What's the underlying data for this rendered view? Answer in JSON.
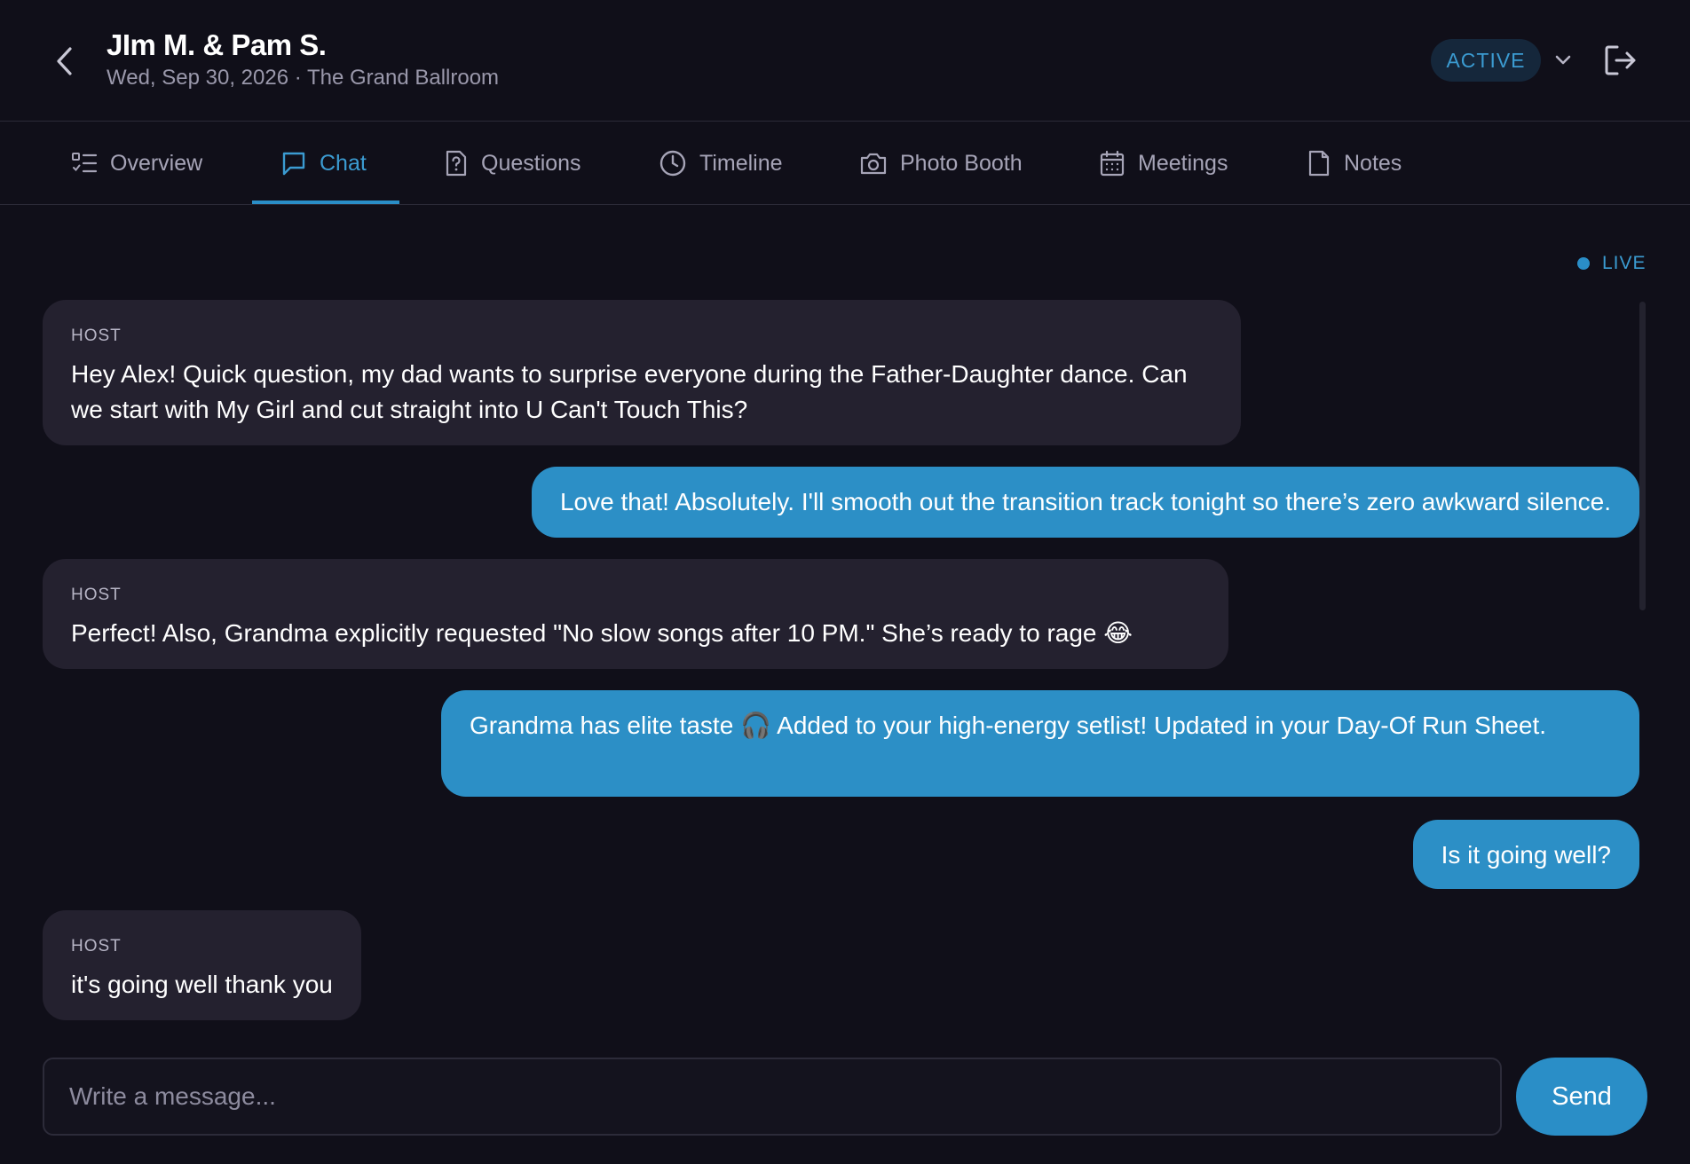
{
  "header": {
    "title": "JIm M. & Pam S.",
    "subtitle": "Wed, Sep 30, 2026 · The Grand Ballroom",
    "status": "ACTIVE"
  },
  "tabs": [
    {
      "label": "Overview",
      "icon": "list-icon",
      "active": false
    },
    {
      "label": "Chat",
      "icon": "chat-icon",
      "active": true
    },
    {
      "label": "Questions",
      "icon": "question-file-icon",
      "active": false
    },
    {
      "label": "Timeline",
      "icon": "clock-icon",
      "active": false
    },
    {
      "label": "Photo Booth",
      "icon": "camera-icon",
      "active": false
    },
    {
      "label": "Meetings",
      "icon": "calendar-icon",
      "active": false
    },
    {
      "label": "Notes",
      "icon": "note-icon",
      "active": false
    }
  ],
  "live_label": "LIVE",
  "messages": [
    {
      "from": "host",
      "sender": "HOST",
      "text": "Hey Alex! Quick question, my dad wants to surprise everyone during the Father-Daughter dance. Can we start with My Girl and cut straight into U Can't Touch This?"
    },
    {
      "from": "me",
      "text": "Love that! Absolutely. I'll smooth out the transition track tonight so there’s zero awkward silence."
    },
    {
      "from": "host",
      "sender": "HOST",
      "text": "Perfect! Also, Grandma explicitly requested \"No slow songs after 10 PM.\" She’s ready to rage 😂"
    },
    {
      "from": "me",
      "text": "Grandma has elite taste 🎧 Added to your high-energy setlist! Updated in your Day-Of Run Sheet."
    },
    {
      "from": "me",
      "text": "Is it going well?"
    },
    {
      "from": "host",
      "sender": "HOST",
      "text": "it's going well thank you"
    }
  ],
  "composer": {
    "placeholder": "Write a message...",
    "send_label": "Send"
  },
  "colors": {
    "background": "#100f19",
    "accent": "#2a8ec7",
    "host_bubble": "#24212f",
    "status_badge_bg": "#15273b"
  }
}
